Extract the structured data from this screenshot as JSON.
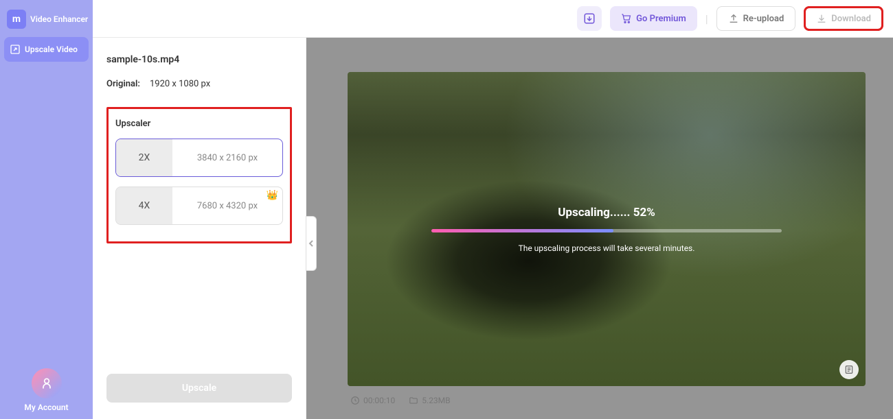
{
  "app": {
    "name": "Video Enhancer"
  },
  "sidebar": {
    "nav": {
      "upscale": "Upscale Video"
    },
    "account": "My Account"
  },
  "header": {
    "premium": "Go Premium",
    "reupload": "Re-upload",
    "download": "Download"
  },
  "panel": {
    "filename": "sample-10s.mp4",
    "original_label": "Original:",
    "original_res": "1920 x 1080 px",
    "upscaler_label": "Upscaler",
    "options": [
      {
        "mult": "2X",
        "res": "3840 x 2160 px"
      },
      {
        "mult": "4X",
        "res": "7680 x 4320 px"
      }
    ],
    "upscale_btn": "Upscale"
  },
  "progress": {
    "label": "Upscaling...... 52%",
    "percent": 52,
    "note": "The upscaling process will take several minutes."
  },
  "meta": {
    "duration": "00:00:10",
    "size": "5.23MB"
  }
}
